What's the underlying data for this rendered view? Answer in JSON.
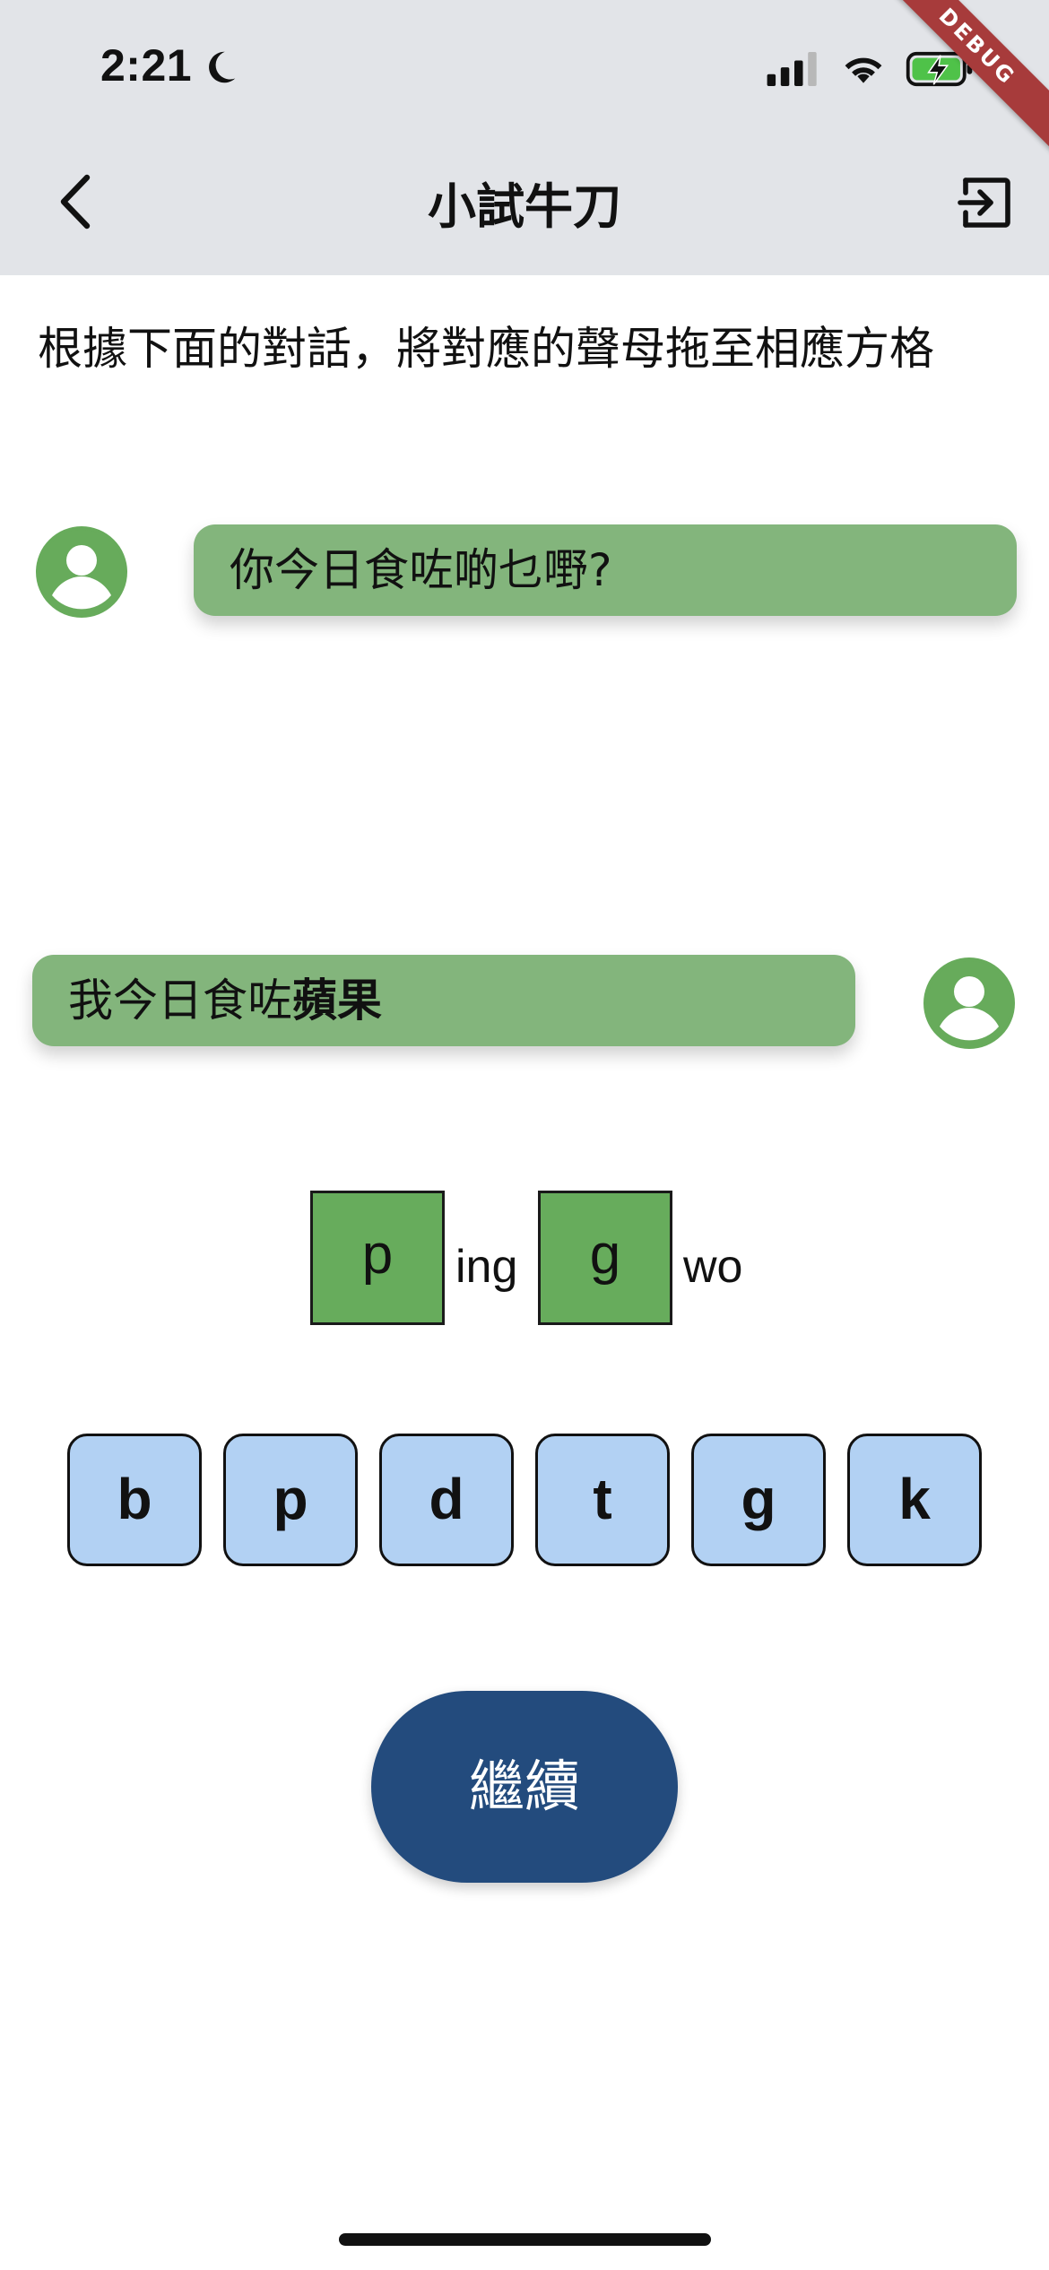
{
  "status_bar": {
    "time": "2:21"
  },
  "debug_banner": "DEBUG",
  "nav": {
    "title": "小試牛刀"
  },
  "instruction": "根據下面的對話，將對應的聲母拖至相應方格",
  "dialogue": {
    "question": "你今日食咗啲乜嘢?",
    "answer_prefix": "我今日食咗",
    "answer_bold": "蘋果"
  },
  "answer_slots": [
    {
      "letter": "p",
      "suffix": "ing"
    },
    {
      "letter": "g",
      "suffix": "wo"
    }
  ],
  "choices": [
    "b",
    "p",
    "d",
    "t",
    "g",
    "k"
  ],
  "continue_label": "繼續",
  "colors": {
    "header_bg": "#e2e4e8",
    "bubble": "#83b57c",
    "avatar": "#67ab5b",
    "slot": "#67ac5c",
    "tile": "#b2d1f3",
    "primary_button": "#234b7d"
  }
}
